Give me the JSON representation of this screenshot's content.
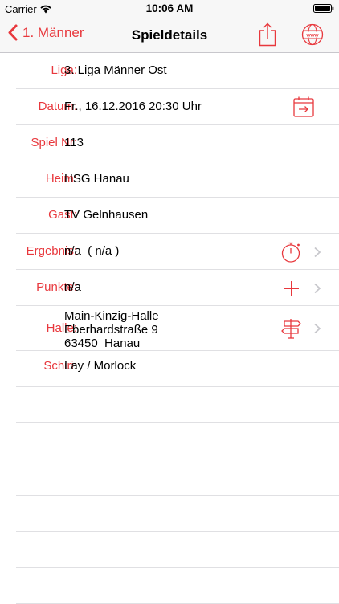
{
  "status_bar": {
    "carrier": "Carrier",
    "time": "10:06 AM",
    "icons": [
      "wifi-icon",
      "battery-icon"
    ]
  },
  "nav": {
    "back_label": "1. Männer",
    "title": "Spieldetails",
    "icons": [
      "chevron-left-icon",
      "share-icon",
      "globe-www-icon"
    ]
  },
  "details": {
    "liga": {
      "label": "Liga:",
      "value": "3. Liga Männer Ost"
    },
    "datum": {
      "label": "Datum:",
      "value": "Fr., 16.12.2016 20:30 Uhr",
      "icon": "calendar-add-icon"
    },
    "spiel_nr": {
      "label": "Spiel Nr:",
      "value": "113"
    },
    "heim": {
      "label": "Heim:",
      "value": "HSG Hanau"
    },
    "gast": {
      "label": "Gast:",
      "value": "TV Gelnhausen"
    },
    "ergebnis": {
      "label": "Ergebnis:",
      "value": "n/a  ( n/a )",
      "icon": "stopwatch-icon"
    },
    "punkte": {
      "label": "Punkte:",
      "value": "n/a",
      "icon": "plus-icon"
    },
    "halle": {
      "label": "Halle:",
      "line1": "Main-Kinzig-Halle",
      "line2": "Eberhardstraße 9",
      "line3": "63450  Hanau",
      "icon": "signpost-icon"
    },
    "schiri": {
      "label": "Schiri:",
      "value": "Lay / Morlock"
    }
  },
  "colors": {
    "accent": "#e8383d",
    "separator": "#e0e0e3",
    "bar_background": "#f7f7f7"
  }
}
